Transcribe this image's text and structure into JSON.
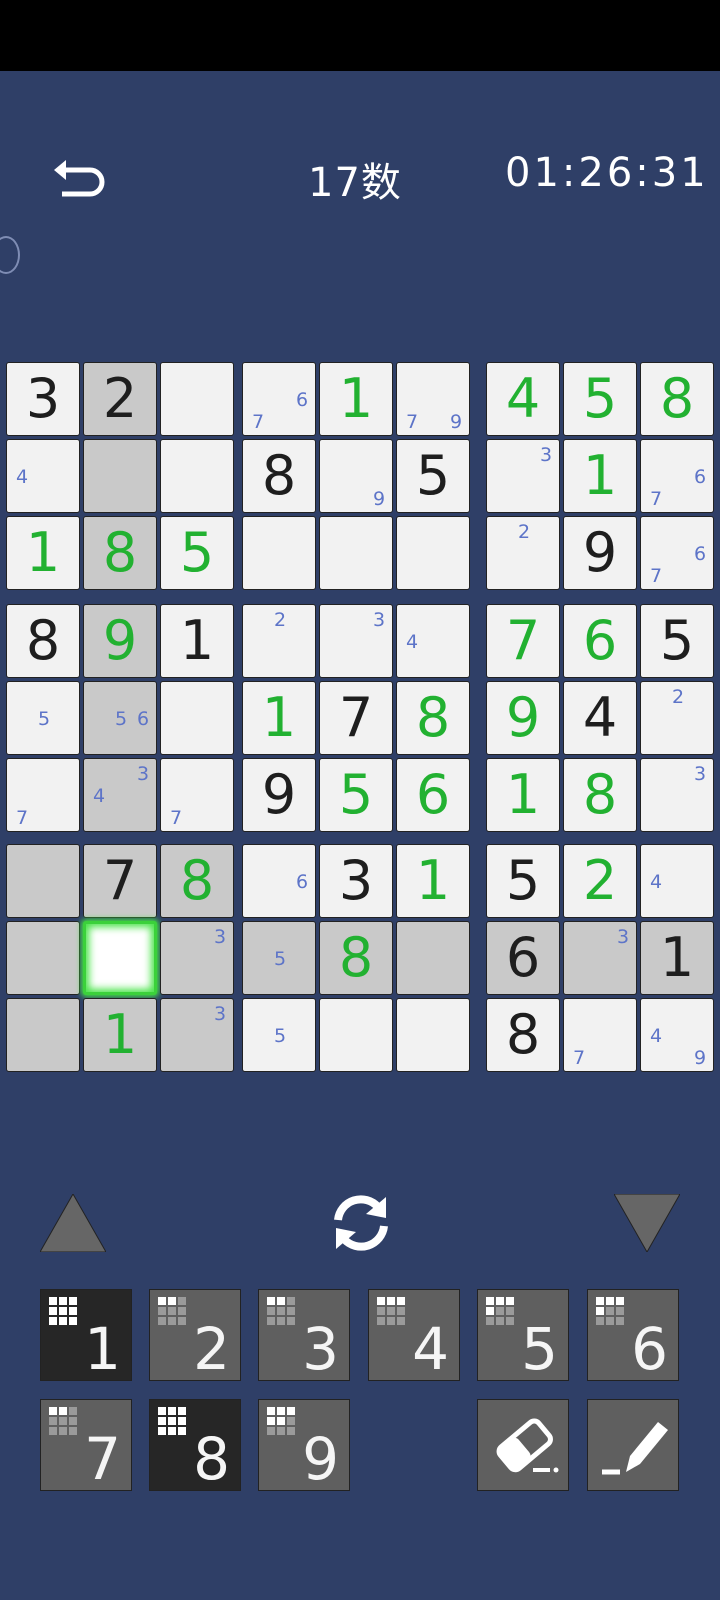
{
  "header": {
    "title": "17数",
    "timer": "01:26:31",
    "undo_icon": "undo-arrow-icon"
  },
  "board": {
    "cells": [
      {
        "v": "3",
        "t": "given",
        "s": 0
      },
      {
        "v": "2",
        "t": "given",
        "s": 1
      },
      {
        "v": "",
        "t": "",
        "s": 0
      },
      {
        "v": "",
        "t": "",
        "s": 0,
        "n": [
          "7",
          "6"
        ]
      },
      {
        "v": "1",
        "t": "user",
        "s": 0
      },
      {
        "v": "",
        "t": "",
        "s": 0,
        "n": [
          "7",
          "9"
        ]
      },
      {
        "v": "4",
        "t": "user",
        "s": 0
      },
      {
        "v": "5",
        "t": "user",
        "s": 0
      },
      {
        "v": "8",
        "t": "user",
        "s": 0
      },
      {
        "v": "",
        "t": "",
        "s": 0,
        "n": [
          "4"
        ]
      },
      {
        "v": "",
        "t": "",
        "s": 1
      },
      {
        "v": "",
        "t": "",
        "s": 0
      },
      {
        "v": "8",
        "t": "given",
        "s": 0
      },
      {
        "v": "",
        "t": "",
        "s": 0,
        "n": [
          "9"
        ]
      },
      {
        "v": "5",
        "t": "given",
        "s": 0
      },
      {
        "v": "",
        "t": "",
        "s": 0,
        "n": [
          "3"
        ]
      },
      {
        "v": "1",
        "t": "user",
        "s": 0
      },
      {
        "v": "",
        "t": "",
        "s": 0,
        "n": [
          "7",
          "6"
        ]
      },
      {
        "v": "1",
        "t": "user",
        "s": 0
      },
      {
        "v": "8",
        "t": "user",
        "s": 1
      },
      {
        "v": "5",
        "t": "user",
        "s": 0
      },
      {
        "v": "",
        "t": "",
        "s": 0
      },
      {
        "v": "",
        "t": "",
        "s": 0
      },
      {
        "v": "",
        "t": "",
        "s": 0
      },
      {
        "v": "",
        "t": "",
        "s": 0,
        "n": [
          "2"
        ]
      },
      {
        "v": "9",
        "t": "given",
        "s": 0
      },
      {
        "v": "",
        "t": "",
        "s": 0,
        "n": [
          "7",
          "6"
        ]
      },
      {
        "v": "8",
        "t": "given",
        "s": 0
      },
      {
        "v": "9",
        "t": "user",
        "s": 1
      },
      {
        "v": "1",
        "t": "given",
        "s": 0
      },
      {
        "v": "",
        "t": "",
        "s": 0,
        "n": [
          "2"
        ]
      },
      {
        "v": "",
        "t": "",
        "s": 0,
        "n": [
          "3"
        ]
      },
      {
        "v": "",
        "t": "",
        "s": 0,
        "n": [
          "4"
        ]
      },
      {
        "v": "7",
        "t": "user",
        "s": 0
      },
      {
        "v": "6",
        "t": "user",
        "s": 0
      },
      {
        "v": "5",
        "t": "given",
        "s": 0
      },
      {
        "v": "",
        "t": "",
        "s": 0,
        "n": [
          "5"
        ]
      },
      {
        "v": "",
        "t": "",
        "s": 1,
        "n": [
          "5",
          "6"
        ]
      },
      {
        "v": "",
        "t": "",
        "s": 0
      },
      {
        "v": "1",
        "t": "user",
        "s": 0
      },
      {
        "v": "7",
        "t": "given",
        "s": 0
      },
      {
        "v": "8",
        "t": "user",
        "s": 0
      },
      {
        "v": "9",
        "t": "user",
        "s": 0
      },
      {
        "v": "4",
        "t": "given",
        "s": 0
      },
      {
        "v": "",
        "t": "",
        "s": 0,
        "n": [
          "2"
        ]
      },
      {
        "v": "",
        "t": "",
        "s": 0,
        "n": [
          "7"
        ]
      },
      {
        "v": "",
        "t": "",
        "s": 1,
        "n": [
          "4",
          "3"
        ]
      },
      {
        "v": "",
        "t": "",
        "s": 0,
        "n": [
          "7"
        ]
      },
      {
        "v": "9",
        "t": "given",
        "s": 0
      },
      {
        "v": "5",
        "t": "user",
        "s": 0
      },
      {
        "v": "6",
        "t": "user",
        "s": 0
      },
      {
        "v": "1",
        "t": "user",
        "s": 0
      },
      {
        "v": "8",
        "t": "user",
        "s": 0
      },
      {
        "v": "",
        "t": "",
        "s": 0,
        "n": [
          "3"
        ]
      },
      {
        "v": "",
        "t": "",
        "s": 1
      },
      {
        "v": "7",
        "t": "given",
        "s": 1
      },
      {
        "v": "8",
        "t": "user",
        "s": 1
      },
      {
        "v": "",
        "t": "",
        "s": 0,
        "n": [
          "6"
        ]
      },
      {
        "v": "3",
        "t": "given",
        "s": 0
      },
      {
        "v": "1",
        "t": "user",
        "s": 0
      },
      {
        "v": "5",
        "t": "given",
        "s": 0
      },
      {
        "v": "2",
        "t": "user",
        "s": 0
      },
      {
        "v": "",
        "t": "",
        "s": 0,
        "n": [
          "4"
        ]
      },
      {
        "v": "",
        "t": "",
        "s": 1
      },
      {
        "v": "",
        "t": "",
        "s": 2
      },
      {
        "v": "",
        "t": "",
        "s": 1,
        "n": [
          "3"
        ]
      },
      {
        "v": "",
        "t": "",
        "s": 1,
        "n": [
          "5"
        ]
      },
      {
        "v": "8",
        "t": "user",
        "s": 1
      },
      {
        "v": "",
        "t": "",
        "s": 1
      },
      {
        "v": "6",
        "t": "given",
        "s": 1
      },
      {
        "v": "",
        "t": "",
        "s": 1,
        "n": [
          "3"
        ]
      },
      {
        "v": "1",
        "t": "given",
        "s": 1
      },
      {
        "v": "",
        "t": "",
        "s": 1
      },
      {
        "v": "1",
        "t": "user",
        "s": 1
      },
      {
        "v": "",
        "t": "",
        "s": 1,
        "n": [
          "3"
        ]
      },
      {
        "v": "",
        "t": "",
        "s": 0,
        "n": [
          "5"
        ]
      },
      {
        "v": "",
        "t": "",
        "s": 0
      },
      {
        "v": "",
        "t": "",
        "s": 0
      },
      {
        "v": "8",
        "t": "given",
        "s": 0
      },
      {
        "v": "",
        "t": "",
        "s": 0,
        "n": [
          "7"
        ]
      },
      {
        "v": "",
        "t": "",
        "s": 0,
        "n": [
          "4",
          "9"
        ]
      }
    ]
  },
  "controls": {
    "up_icon": "triangle-up-icon",
    "refresh_icon": "refresh-icon",
    "down_icon": "triangle-down-icon",
    "keys": [
      {
        "label": "1",
        "dark": true,
        "grid": [
          1,
          1,
          1,
          1,
          1,
          1,
          1,
          1,
          1
        ]
      },
      {
        "label": "2",
        "dark": false,
        "grid": [
          1,
          1,
          0,
          0,
          0,
          0,
          0,
          0,
          0
        ]
      },
      {
        "label": "3",
        "dark": false,
        "grid": [
          1,
          1,
          0,
          0,
          0,
          0,
          0,
          0,
          0
        ]
      },
      {
        "label": "4",
        "dark": false,
        "grid": [
          1,
          1,
          1,
          0,
          0,
          0,
          0,
          0,
          0
        ]
      },
      {
        "label": "5",
        "dark": false,
        "grid": [
          1,
          1,
          1,
          1,
          0,
          0,
          0,
          0,
          0
        ]
      },
      {
        "label": "6",
        "dark": false,
        "grid": [
          1,
          1,
          1,
          1,
          0,
          0,
          0,
          0,
          0
        ]
      },
      {
        "label": "7",
        "dark": false,
        "grid": [
          1,
          1,
          0,
          0,
          0,
          0,
          0,
          0,
          0
        ]
      },
      {
        "label": "8",
        "dark": true,
        "grid": [
          1,
          1,
          1,
          1,
          1,
          1,
          1,
          1,
          1
        ]
      },
      {
        "label": "9",
        "dark": false,
        "grid": [
          1,
          1,
          1,
          1,
          1,
          0,
          0,
          0,
          0
        ]
      }
    ],
    "eraser_icon": "eraser-icon",
    "pencil_icon": "pencil-icon"
  }
}
